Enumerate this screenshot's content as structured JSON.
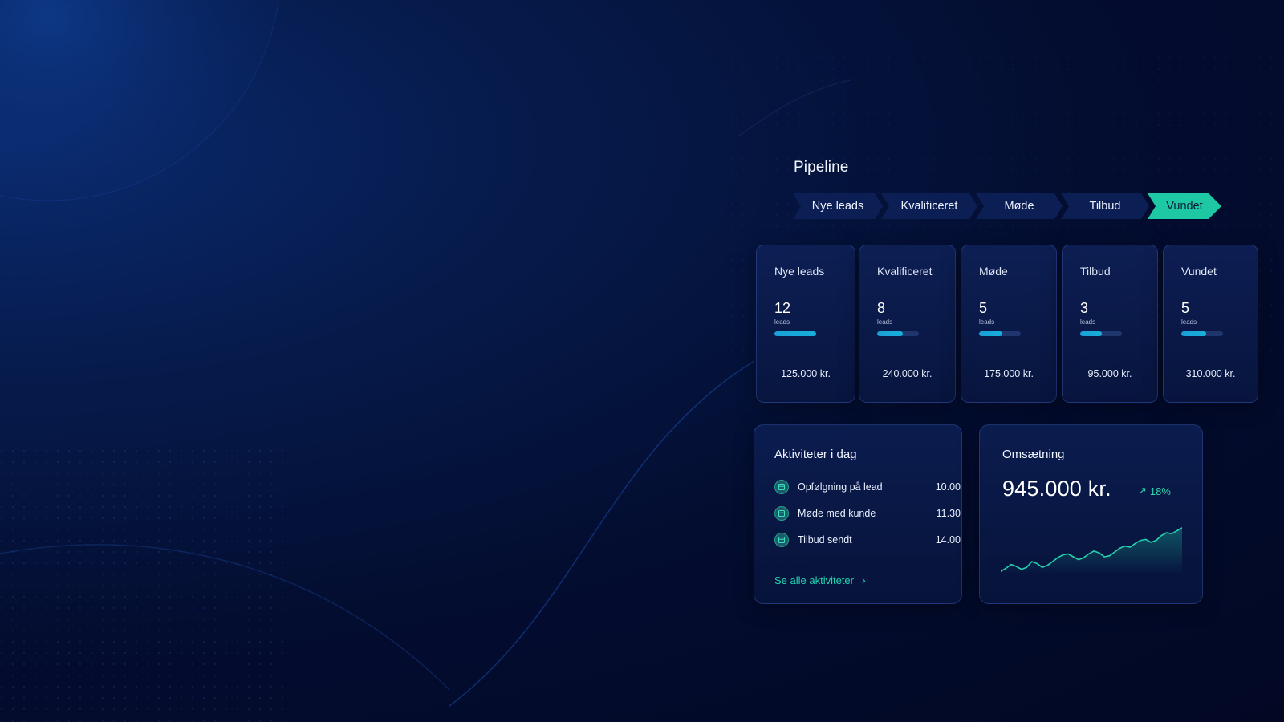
{
  "pipeline": {
    "title": "Pipeline",
    "steps": [
      {
        "label": "Nye leads",
        "active": false
      },
      {
        "label": "Kvalificeret",
        "active": false
      },
      {
        "label": "Møde",
        "active": false
      },
      {
        "label": "Tilbud",
        "active": false
      },
      {
        "label": "Vundet",
        "active": true
      }
    ]
  },
  "stages": [
    {
      "title": "Nye leads",
      "count": "12",
      "unit": "leads",
      "amount": "125.000 kr.",
      "progress": 1.0
    },
    {
      "title": "Kvalificeret",
      "count": "8",
      "unit": "leads",
      "amount": "240.000 kr.",
      "progress": 0.62
    },
    {
      "title": "Møde",
      "count": "5",
      "unit": "leads",
      "amount": "175.000 kr.",
      "progress": 0.55
    },
    {
      "title": "Tilbud",
      "count": "3",
      "unit": "leads",
      "amount": "95.000 kr.",
      "progress": 0.52
    },
    {
      "title": "Vundet",
      "count": "5",
      "unit": "leads",
      "amount": "310.000 kr.",
      "progress": 0.6
    }
  ],
  "activities": {
    "title": "Aktiviteter i dag",
    "items": [
      {
        "label": "Opfølgning på lead",
        "time": "10.00"
      },
      {
        "label": "Møde med kunde",
        "time": "11.30"
      },
      {
        "label": "Tilbud sendt",
        "time": "14.00"
      }
    ],
    "link_label": "Se alle aktiviteter"
  },
  "revenue": {
    "title": "Omsætning",
    "value": "945.000 kr.",
    "trend": "18%",
    "sparkline": [
      10,
      16,
      24,
      20,
      14,
      18,
      30,
      26,
      18,
      22,
      30,
      38,
      44,
      46,
      40,
      34,
      38,
      46,
      52,
      48,
      40,
      42,
      50,
      58,
      62,
      60,
      68,
      74,
      76,
      70,
      74,
      84,
      90,
      88,
      94,
      100
    ]
  },
  "colors": {
    "accent": "#1fc8a5",
    "progress": "#1a9fd8",
    "card_bg": "#0c1f55",
    "page_bg": "#020824"
  }
}
